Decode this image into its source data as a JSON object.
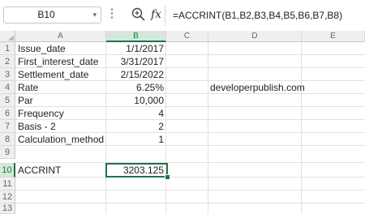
{
  "name_box": {
    "value": "B10"
  },
  "formula_bar": {
    "formula": "=ACCRINT(B1,B2,B3,B4,B5,B6,B7,B8)"
  },
  "icons": {
    "name_box_dropdown": "chevron-down-icon",
    "options_dots": "vertical-dots-icon",
    "zoom": "zoom-in-icon",
    "insert_function": "fx-icon"
  },
  "columns": [
    "A",
    "B",
    "C",
    "D",
    "E"
  ],
  "selected_column": "B",
  "rows": [
    "1",
    "2",
    "3",
    "4",
    "5",
    "6",
    "7",
    "8",
    "9",
    "10",
    "11",
    "12",
    "13"
  ],
  "selected_row": "10",
  "labels": {
    "issue_date": "Issue_date",
    "first_interest_date": "First_interest_date",
    "settlement_date": "Settlement_date",
    "rate": "Rate",
    "par": "Par",
    "frequency": "Frequency",
    "basis": "Basis - 2",
    "calculation_method": "Calculation_method",
    "accrint": "ACCRINT"
  },
  "values": {
    "issue_date": "1/1/2017",
    "first_interest_date": "3/31/2017",
    "settlement_date": "2/15/2022",
    "rate": "6.25%",
    "par": "10,000",
    "frequency": "4",
    "basis": "2",
    "calculation_method": "1",
    "accrint": "3203.125"
  },
  "note": {
    "text": "developerpublish.com"
  },
  "colors": {
    "accent": "#217346",
    "selected_header": "#d3e8da"
  }
}
